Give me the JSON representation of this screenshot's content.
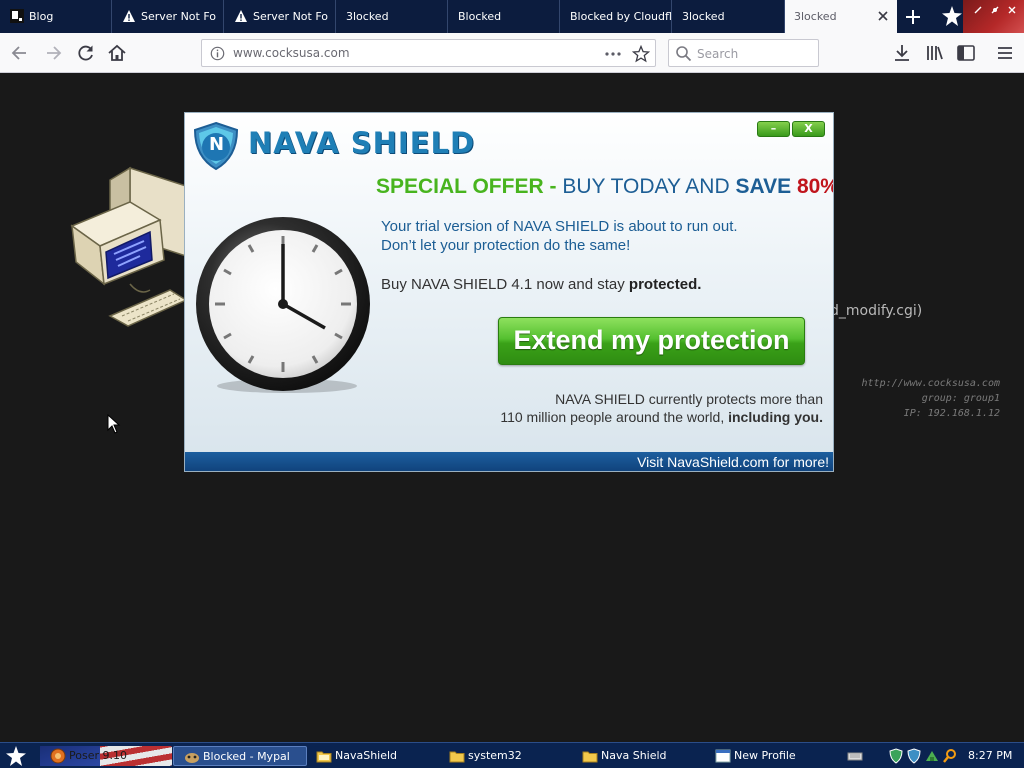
{
  "browser": {
    "tabs": [
      {
        "label": "Blog",
        "icon": "blog-favicon-icon",
        "active": false
      },
      {
        "label": "Server Not Fo",
        "icon": "warning-icon",
        "active": false
      },
      {
        "label": "Server Not Fo",
        "icon": "warning-icon",
        "active": false
      },
      {
        "label": "3locked",
        "icon": "",
        "active": false
      },
      {
        "label": "Blocked",
        "icon": "",
        "active": false
      },
      {
        "label": "Blocked by Cloudfla",
        "icon": "",
        "active": false
      },
      {
        "label": "3locked",
        "icon": "",
        "active": false
      },
      {
        "label": "3locked",
        "icon": "",
        "active": true
      }
    ],
    "url": "www.cocksusa.com",
    "search_placeholder": "Search"
  },
  "background_page": {
    "cgi_text": "d_modify.cgi)",
    "mono_lines": [
      "http://www.cocksusa.com",
      "group: group1",
      "IP: 192.168.1.12"
    ]
  },
  "popup": {
    "brand": "NAVA SHIELD",
    "brand_letter": "N",
    "minimize_label": "–",
    "close_label": "X",
    "offer": {
      "special": "SPECIAL OFFER -",
      "mid": "BUY TODAY AND",
      "save": "SAVE",
      "percent": "80%"
    },
    "trial_line_1": "Your trial version of NAVA SHIELD is about to run out.",
    "trial_line_2": "Don’t let your protection do the same!",
    "buy_text": "Buy NAVA SHIELD 4.1 now and stay",
    "buy_bold": "protected.",
    "cta_label": "Extend my protection",
    "stats_line_1": "NAVA SHIELD currently protects more than",
    "stats_line_2_text": "110 million people around the world,",
    "stats_line_2_bold": "including you.",
    "footer_link": "Visit NavaShield.com for more!"
  },
  "taskbar": {
    "items": [
      {
        "label": "Poser 9.10",
        "icon": "poser-icon"
      },
      {
        "label": "Blocked - Mypal",
        "icon": "mypal-browser-icon"
      },
      {
        "label": "NavaShield",
        "icon": "folder-icon"
      },
      {
        "label": "system32",
        "icon": "folder-icon"
      },
      {
        "label": "Nava Shield",
        "icon": "folder-icon"
      },
      {
        "label": "New Profile",
        "icon": "window-icon"
      }
    ],
    "time": "8:27 PM"
  },
  "colors": {
    "brand_blue": "#1f7fb6",
    "offer_green": "#48b41e",
    "offer_red": "#c0141c",
    "cta_green": "#3aa118",
    "footer_blue": "#0f4079",
    "tabstrip": "#0c1c3e",
    "taskbar": "#0a2350"
  }
}
